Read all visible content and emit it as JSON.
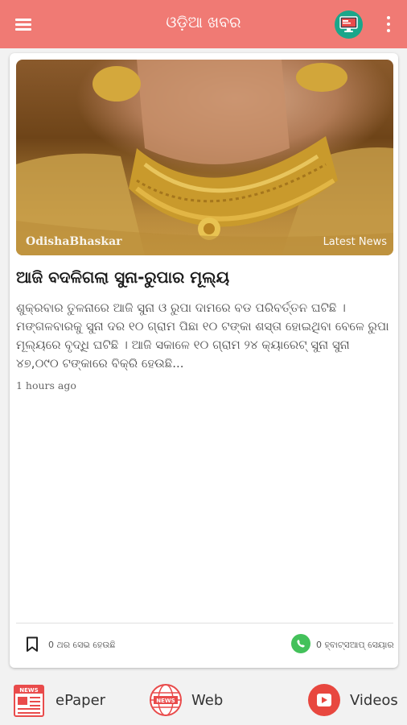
{
  "header": {
    "title": "ଓଡ଼ିଆ ଖବର",
    "colors": {
      "primary": "#f07a74",
      "tv_badge": "#1aa68a"
    }
  },
  "article": {
    "image_watermark": "OdishaBhaskar",
    "image_tag": "Latest News",
    "headline": "ଆଜି ବଦଳିଗଲା ସୁନା-ରୁପାର ମୂଲ୍ୟ",
    "summary": "ଶୁକ୍ରବାର ତୁଳନାରେ ଆଜି ସୁନା ଓ ରୁପା ଦାମରେ ବଡ ପରିବର୍ତ୍ତନ ଘଟିଛି । ମଙ୍ଗଳବାରକୁ ସୁନା ଦର ୧୦ ଗ୍ରାମ ପିଛା ୧୦ ଟଙ୍କା ଶସ୍ତା ହୋଇଥିବା ବେଳେ ରୁପା ମୂଲ୍ୟରେ ବୃଦ୍ଧି ଘଟିଛି । ଆଜି ସକାଳେ ୧୦ ଗ୍ରାମ ୨୪ କ୍ୟାରେଟ୍ ସୁନା ସୁନା ୪୭,୦୯୦ ଟଙ୍କାରେ ବିକ୍ରି ହେଉଛି...",
    "time_ago": "1 hours ago",
    "bookmark_text": "0 ଥର ସେଭ ହେଉଛି",
    "share_text": "0 ହ୍ବାଟ୍ସଆପ୍ ସେୟାର"
  },
  "bottom_nav": {
    "epaper": "ePaper",
    "web": "Web",
    "videos": "Videos",
    "colors": {
      "icon_red": "#e94b4b",
      "videos_red": "#e8473f"
    }
  },
  "icons": [
    "menu-icon",
    "tv-news-icon",
    "more-vert-icon",
    "bookmark-icon",
    "whatsapp-icon",
    "epaper-icon",
    "globe-news-icon",
    "play-icon"
  ]
}
